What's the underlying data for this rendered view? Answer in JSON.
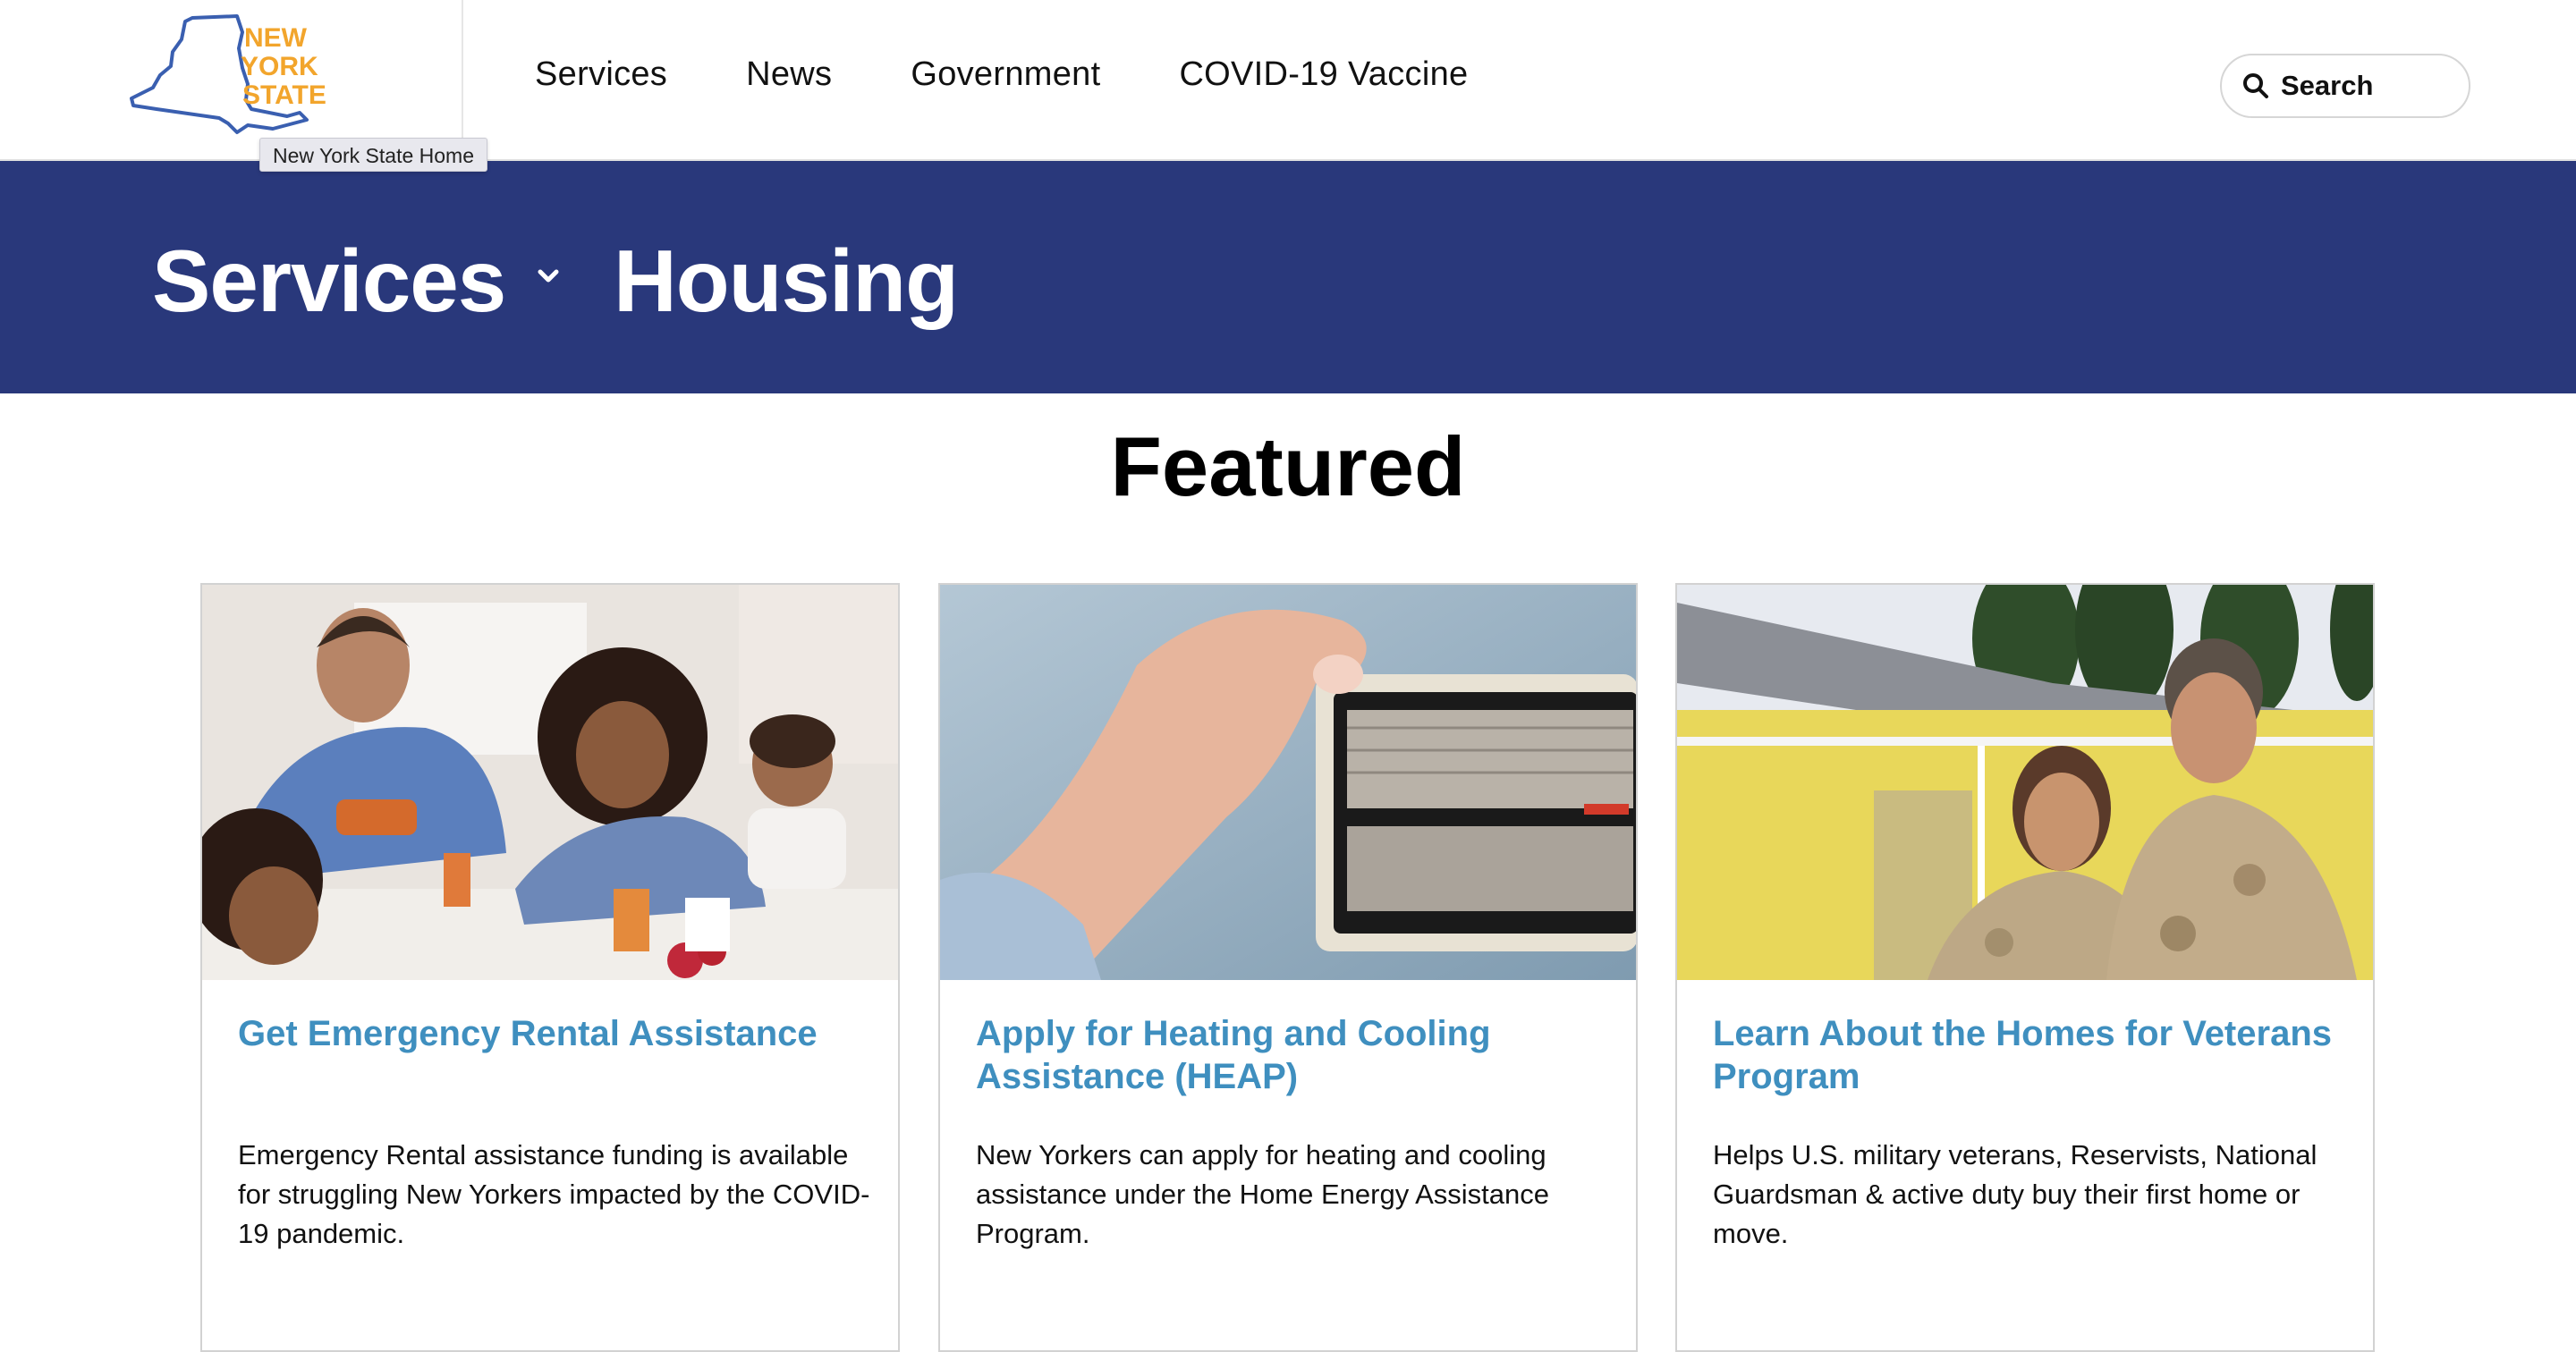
{
  "header": {
    "logo": {
      "lines": [
        "NEW",
        "YORK",
        "STATE"
      ],
      "tooltip": "New York State Home",
      "color_outline": "#3a5fb0",
      "color_text": "#f2a52c"
    },
    "nav": [
      {
        "label": "Services"
      },
      {
        "label": "News"
      },
      {
        "label": "Government"
      },
      {
        "label": "COVID-19 Vaccine"
      }
    ],
    "search": {
      "label": "Search",
      "icon": "search-icon"
    }
  },
  "banner": {
    "background": "#29387b",
    "breadcrumb_parent": "Services",
    "breadcrumb_current": "Housing",
    "chevron_icon": "chevron-down-icon"
  },
  "featured": {
    "title": "Featured",
    "cards": [
      {
        "title": "Get Emergency Rental Assistance",
        "description": "Emergency Rental assistance funding is available for struggling New Yorkers impacted by the COVID-19 pandemic.",
        "image": "family-breakfast-photo"
      },
      {
        "title": "Apply for Heating and Cooling Assistance (HEAP)",
        "description": "New Yorkers can apply for heating and cooling assistance under the Home Energy Assistance Program.",
        "image": "thermostat-photo"
      },
      {
        "title": "Learn About the Homes for Veterans Program",
        "description": "Helps U.S. military veterans, Reservists, National Guardsman & active duty buy their first home or move.",
        "image": "veterans-house-photo"
      }
    ]
  },
  "colors": {
    "link_blue": "#3f8fbf",
    "banner_blue": "#29387b"
  }
}
